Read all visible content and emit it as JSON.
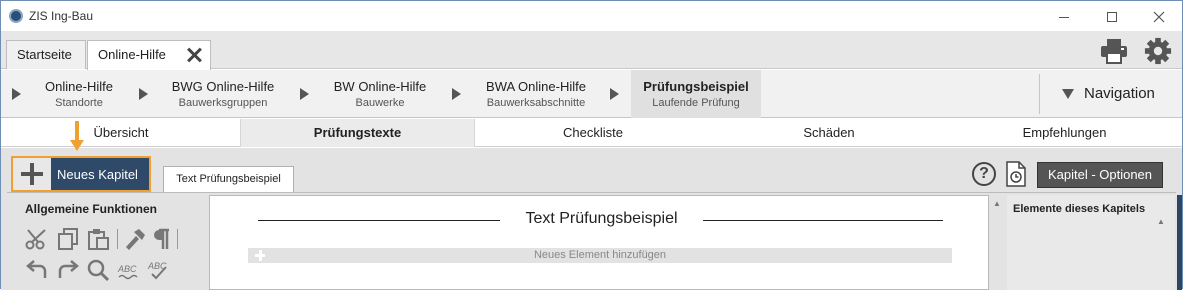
{
  "window": {
    "title": "ZIS Ing-Bau"
  },
  "tabs": [
    {
      "label": "Startseite"
    },
    {
      "label": "Online-Hilfe"
    }
  ],
  "toolbar": {
    "icons": [
      "printer-icon",
      "gear-icon"
    ]
  },
  "breadcrumbs": [
    {
      "title": "Online-Hilfe",
      "subtitle": "Standorte"
    },
    {
      "title": "BWG Online-Hilfe",
      "subtitle": "Bauwerksgruppen"
    },
    {
      "title": "BW Online-Hilfe",
      "subtitle": "Bauwerke"
    },
    {
      "title": "BWA Online-Hilfe",
      "subtitle": "Bauwerksabschnitte"
    },
    {
      "title": "Prüfungsbeispiel",
      "subtitle": "Laufende Prüfung"
    }
  ],
  "navigation": {
    "label": "Navigation"
  },
  "subtabs": [
    {
      "label": "Übersicht"
    },
    {
      "label": "Prüfungstexte"
    },
    {
      "label": "Checkliste"
    },
    {
      "label": "Schäden"
    },
    {
      "label": "Empfehlungen"
    }
  ],
  "workspace": {
    "new_chapter_label": "Neues Kapitel",
    "document_tab": "Text Prüfungsbeispiel",
    "chapter_options_label": "Kapitel - Optionen",
    "general_functions_title": "Allgemeine Funktionen",
    "editor_title": "Text Prüfungsbeispiel",
    "add_element_label": "Neues Element hinzufügen",
    "chapter_elements_title": "Elemente dieses Kapitels"
  },
  "colors": {
    "accent_dark": "#2f4a69",
    "highlight_orange": "#f0a030"
  }
}
